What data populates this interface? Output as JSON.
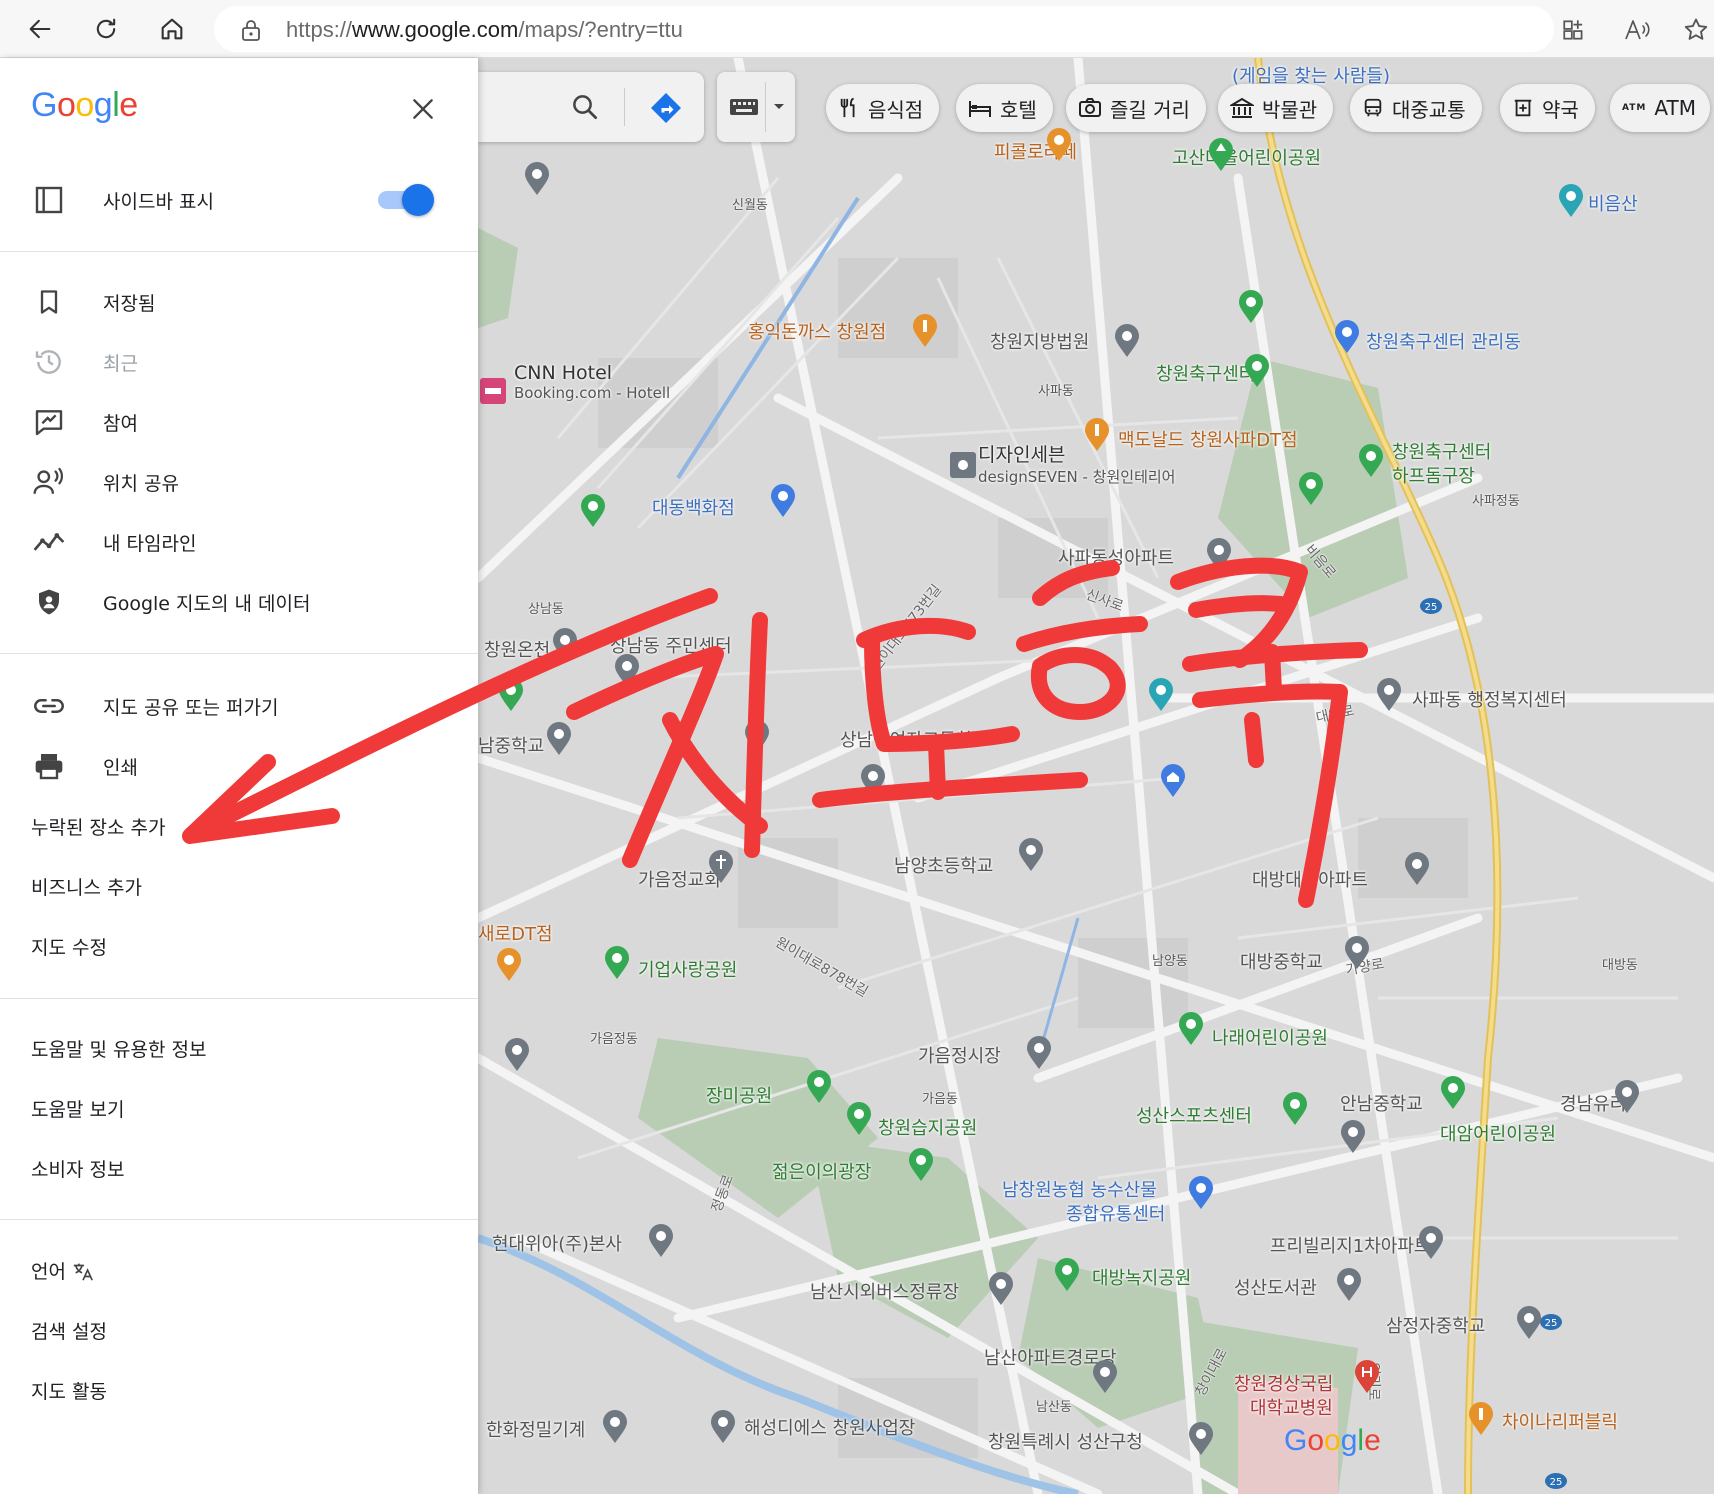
{
  "browser": {
    "url_scheme": "https://",
    "url_host": "www.google.com",
    "url_path": "/maps/?entry=ttu"
  },
  "map": {
    "search_placeholder": "",
    "chips": [
      {
        "label": "음식점",
        "icon": "fork-knife-icon"
      },
      {
        "label": "호텔",
        "icon": "bed-icon"
      },
      {
        "label": "즐길 거리",
        "icon": "camera-icon"
      },
      {
        "label": "박물관",
        "icon": "museum-icon"
      },
      {
        "label": "대중교통",
        "icon": "bus-icon"
      },
      {
        "label": "약국",
        "icon": "pharmacy-icon"
      },
      {
        "label": "ATM",
        "icon": "atm-icon"
      }
    ],
    "labels": {
      "pikol": "피콜로라떼",
      "gosan_park": "고산마을어린이공원",
      "biumsan": "비음산",
      "hongik": "홍익돈까스 창원점",
      "court": "창원지방법원",
      "football_office": "창원축구센터 관리동",
      "cnn_hotel": "CNN Hotel",
      "cnn_sub": "Booking.com - Hotell",
      "football_center": "창원축구센터",
      "mcdonalds": "맥도날드 창원사파DT점",
      "design7": "디자인세븐",
      "design7_sub": "designSEVEN - 창원인테리어",
      "football_field_1": "창원축구센터",
      "football_field_2": "하프돔구장",
      "daedong_dept": "대동백화점",
      "sapa_apt": "사파동성아파트",
      "sangnam_center": "상남동 주민센터",
      "changwon_oncheon": "창원온천",
      "sapa_welfare": "사파동 행정복지센터",
      "namjung": "남중학교",
      "gaeum_church": "가음정교회",
      "namyang_elem": "남양초등학교",
      "daebang_apt": "대방대동아파트",
      "dt_shop": "새로DT점",
      "gieop_park": "기업사랑공원",
      "daebang_middle": "대방중학교",
      "narae_park": "나래어린이공원",
      "gaeum_market": "가음정시장",
      "jangmi_park": "장미공원",
      "wetland_park": "창원습지공원",
      "seongsan_sports": "성산스포츠센터",
      "annam_middle": "안남중학교",
      "gyeongnam_glass": "경남유리",
      "daeam_park": "대암어린이공원",
      "youth_square": "젊은이의광장",
      "nonghyup_1": "남창원농협 농수산물",
      "nonghyup_2": "종합유통센터",
      "hyundai_wia": "현대위아(주)본사",
      "freeville": "프리빌리지1차아파트",
      "namsan_bus": "남산시외버스정류장",
      "daebang_green": "대방녹지공원",
      "seongsan_library": "성산도서관",
      "samjeongja_middle": "삼정자중학교",
      "namsan_senior": "남산아파트경로당",
      "gyeongsang_hosp_1": "창원경상국립",
      "gyeongsang_hosp_2": "대학교병원",
      "hanwha": "한화정밀기계",
      "haesung": "해성디에스 창원사업장",
      "seongsan_gu": "창원특례시 성산구청",
      "chinese": "차이나리퍼블릭",
      "gamers": "(게임을 찾는 사람들)",
      "sangnam_girls": "상남중여자고등학교",
      "daeam_apt": "대암로",
      "dong_sapa": "사파동",
      "dong_sinwol": "신월동",
      "dong_sangnam": "상남동",
      "dong_namyang": "남양동",
      "dong_gaeum": "가음정동",
      "dong_gaeum2": "가음동",
      "dong_daebang": "대방동",
      "dong_namsan": "남산동",
      "dong_sapa2": "사파정동",
      "road_wonidae773": "원이대로773번길",
      "road_wonidae878": "원이대로878번길",
      "road_sinsaro": "신사로",
      "road_gayangro": "가양로",
      "road_daeamro": "대암로",
      "road_biumro": "비음로",
      "road_jeongdongro": "정동로",
      "road_changidae": "창이대로",
      "road_oeri": "외리로"
    },
    "watermark": "Google"
  },
  "menu": {
    "logo": "Google",
    "sidebar_toggle_label": "사이드바 표시",
    "sidebar_toggle_on": true,
    "items_group1": [
      {
        "label": "저장됨",
        "icon": "bookmark-icon",
        "disabled": false
      },
      {
        "label": "최근",
        "icon": "history-icon",
        "disabled": true
      },
      {
        "label": "참여",
        "icon": "contribute-icon",
        "disabled": false
      },
      {
        "label": "위치 공유",
        "icon": "location-sharing-icon",
        "disabled": false
      },
      {
        "label": "내 타임라인",
        "icon": "timeline-icon",
        "disabled": false
      },
      {
        "label": "Google 지도의 내 데이터",
        "icon": "shield-icon",
        "disabled": false
      }
    ],
    "items_group2": [
      {
        "label": "지도 공유 또는 퍼가기",
        "icon": "link-icon"
      },
      {
        "label": "인쇄",
        "icon": "print-icon"
      },
      {
        "label": "누락된 장소 추가"
      },
      {
        "label": "비즈니스 추가"
      },
      {
        "label": "지도 수정"
      }
    ],
    "items_group3": [
      {
        "label": "도움말 및 유용한 정보"
      },
      {
        "label": "도움말 보기"
      },
      {
        "label": "소비자 정보"
      }
    ],
    "items_group4": [
      {
        "label": "언어"
      },
      {
        "label": "검색 설정"
      },
      {
        "label": "지도 활동"
      }
    ]
  },
  "annotation": {
    "handwritten_text": "지도등록",
    "color": "#f03a3a"
  }
}
